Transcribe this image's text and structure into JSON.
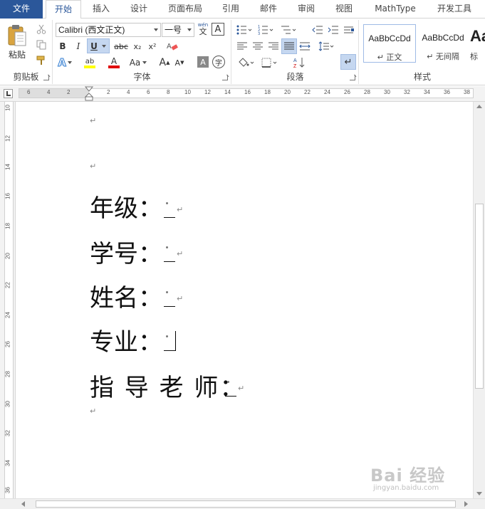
{
  "tabs": [
    "文件",
    "开始",
    "插入",
    "设计",
    "页面布局",
    "引用",
    "邮件",
    "审阅",
    "视图",
    "MathType",
    "开发工具"
  ],
  "ribbon": {
    "clipboard": {
      "paste_label": "粘贴",
      "group_label": "剪贴板"
    },
    "font": {
      "font_name": "Calibri (西文正文)",
      "font_size": "一号",
      "phonetic_label": "wén",
      "bold": "B",
      "italic": "I",
      "underline": "U",
      "strike": "abc",
      "subscript": "x₂",
      "superscript": "x²",
      "case_label": "Aa",
      "grow": "A",
      "shrink": "A",
      "group_label": "字体"
    },
    "paragraph": {
      "group_label": "段落"
    },
    "styles": {
      "items": [
        {
          "sample": "AaBbCcDd",
          "name": "↵ 正文"
        },
        {
          "sample": "AaBbCcDd",
          "name": "↵ 无间隔"
        },
        {
          "sample": "Aa",
          "name": "标"
        }
      ],
      "group_label": "样式"
    }
  },
  "ruler": {
    "top_ticks": [
      "6",
      "4",
      "2",
      "2",
      "4",
      "6",
      "8",
      "10",
      "12",
      "14",
      "16",
      "18",
      "20",
      "22",
      "24",
      "26",
      "28",
      "30",
      "32",
      "34",
      "36",
      "38"
    ],
    "side_ticks": [
      "10",
      "12",
      "14",
      "16",
      "18",
      "20",
      "22",
      "24",
      "26",
      "28",
      "30",
      "32",
      "34",
      "36"
    ]
  },
  "document": {
    "lines": [
      {
        "label": "年级："
      },
      {
        "label": "学号："
      },
      {
        "label": "姓名："
      },
      {
        "label": "专业："
      },
      {
        "label": "指 导 老 师："
      }
    ],
    "para_mark": "↵"
  },
  "watermark": {
    "main": "Bai 经验",
    "sub": "jingyan.baidu.com"
  },
  "colors": {
    "file_tab": "#2b579a",
    "accent": "#2b579a",
    "highlight": "#ffff00",
    "font_color": "#e00000"
  }
}
